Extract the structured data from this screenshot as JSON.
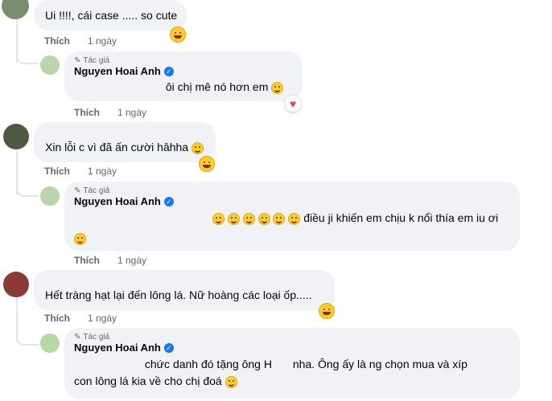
{
  "comments": [
    {
      "text": "Ui !!!!, cái case ..... so cute",
      "like": "Thích",
      "time": "1 ngày"
    },
    {
      "author_tag": "Tác giả",
      "author": "Nguyen Hoai Anh",
      "text": "ôi chị mê nó hơn em",
      "like": "Thích",
      "time": "1 ngày"
    },
    {
      "text": "Xin lỗi c vì đã ấn cười hâhha",
      "like": "Thích",
      "time": "1 ngày"
    },
    {
      "author_tag": "Tác giả",
      "author": "Nguyen Hoai Anh",
      "text": "điều ji khiến em chịu k nổi thía em iu ơi",
      "like": "Thích",
      "time": "1 ngày"
    },
    {
      "text": "Hết tràng hạt lại đến lông lá. Nữ hoàng các loại ốp.....",
      "like": "Thích",
      "time": "1 ngày"
    },
    {
      "author_tag": "Tác giả",
      "author": "Nguyen Hoai Anh",
      "text_line1_a": "chức danh đó tặng ông H",
      "text_line1_b": "nha. Ông ấy là ng chọn mua và xíp",
      "text_line2": "con lông lá kia về cho chị đoá"
    }
  ],
  "colors": {
    "bubble": "#f0f2f5",
    "meta": "#65676b",
    "verified": "#1877f2",
    "emoji": "#ffcc33",
    "heart": "#f33e58"
  }
}
